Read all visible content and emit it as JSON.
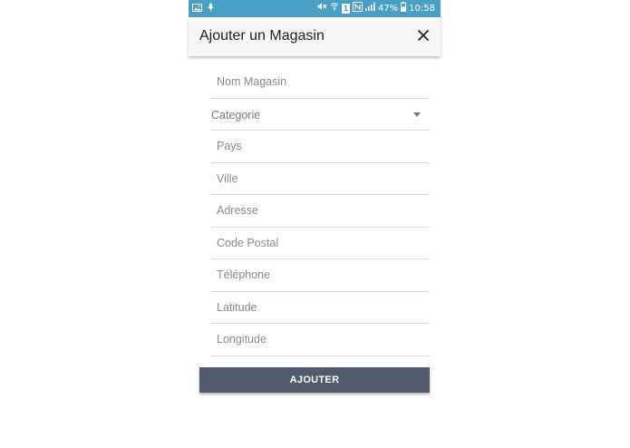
{
  "status_bar": {
    "left_icons": [
      "image-icon",
      "mic-icon"
    ],
    "right_icons": [
      "mute-icon",
      "wifi-icon",
      "sim-icon",
      "nfc-icon",
      "signal-icon",
      "battery-icon"
    ],
    "sim_label": "1",
    "battery_percent": "47%",
    "time": "10:58",
    "color": "#4a9fc4"
  },
  "dialog": {
    "title": "Ajouter un Magasin",
    "close_icon": "close-icon"
  },
  "form": {
    "nom_magasin": {
      "placeholder": "Nom Magasin"
    },
    "categorie": {
      "value": "Categorie",
      "icon": "chevron-down-icon"
    },
    "pays": {
      "placeholder": "Pays"
    },
    "ville": {
      "placeholder": "Ville"
    },
    "adresse": {
      "placeholder": "Adresse"
    },
    "code_postal": {
      "placeholder": "Code Postal"
    },
    "telephone": {
      "placeholder": "Téléphone"
    },
    "latitude": {
      "placeholder": "Latitude"
    },
    "longitude": {
      "placeholder": "Longitude"
    }
  },
  "submit": {
    "label": "AJOUTER",
    "color": "#515b6b"
  }
}
